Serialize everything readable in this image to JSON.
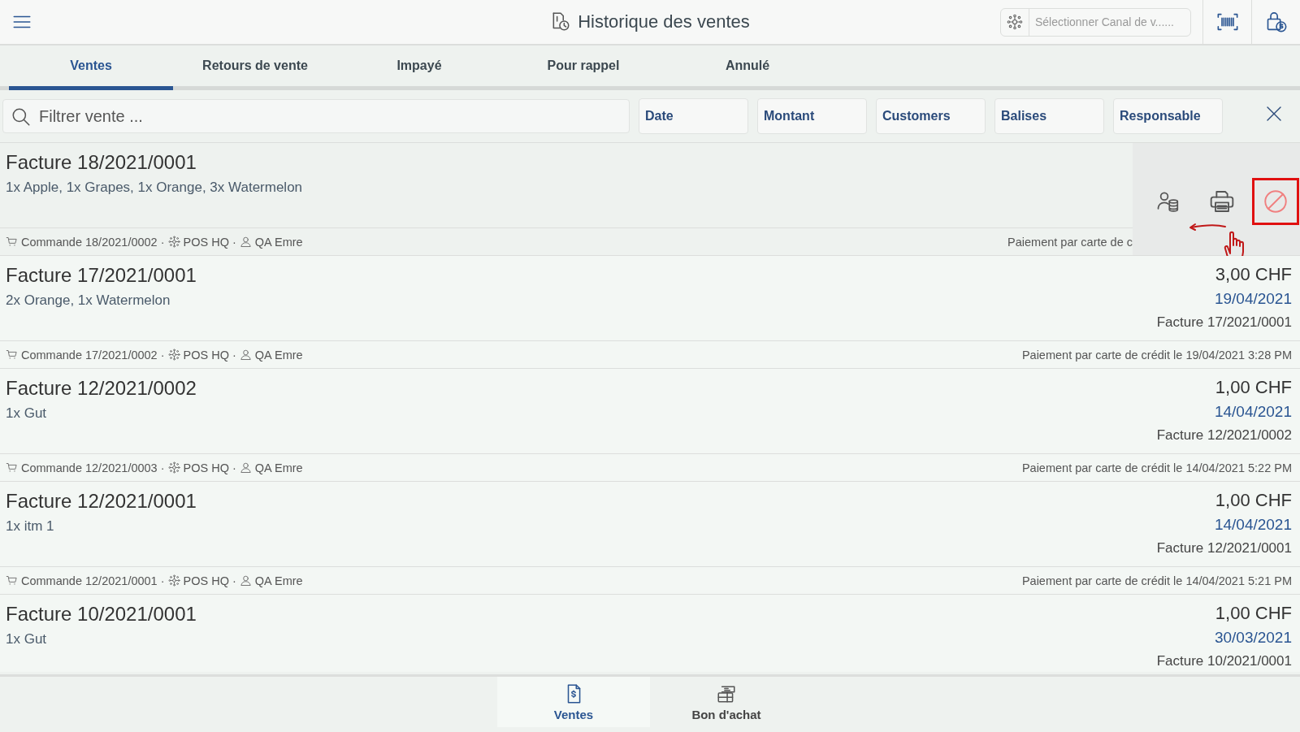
{
  "header": {
    "title": "Historique des ventes",
    "channel_placeholder": "Sélectionner Canal de v......"
  },
  "tabs": [
    {
      "label": "Ventes",
      "selected": true
    },
    {
      "label": "Retours de vente",
      "selected": false
    },
    {
      "label": "Impayé",
      "selected": false
    },
    {
      "label": "Pour rappel",
      "selected": false
    },
    {
      "label": "Annulé",
      "selected": false
    }
  ],
  "filter": {
    "placeholder": "Filtrer vente ...",
    "chips": [
      "Date",
      "Montant",
      "Customers",
      "Balises",
      "Responsable"
    ]
  },
  "rows": [
    {
      "title": "Facture 18/2021/0001",
      "items": "1x Apple, 1x Grapes, 1x Orange, 3x Watermelon",
      "order": "Commande 18/2021/0002 ·",
      "channel": "POS HQ ·",
      "user": "QA Emre",
      "payment": "Paiement par carte de c",
      "actions_open": true
    },
    {
      "title": "Facture 17/2021/0001",
      "items": "2x Orange, 1x Watermelon",
      "amount": "3,00 CHF",
      "date": "19/04/2021",
      "invoice": "Facture 17/2021/0001",
      "order": "Commande 17/2021/0002 ·",
      "channel": "POS HQ ·",
      "user": "QA Emre",
      "payment": "Paiement par carte de crédit le 19/04/2021 3:28 PM",
      "actions_open": false
    },
    {
      "title": "Facture 12/2021/0002",
      "items": "1x Gut",
      "amount": "1,00 CHF",
      "date": "14/04/2021",
      "invoice": "Facture 12/2021/0002",
      "order": "Commande 12/2021/0003 ·",
      "channel": "POS HQ ·",
      "user": "QA Emre",
      "payment": "Paiement par carte de crédit le 14/04/2021 5:22 PM",
      "actions_open": false
    },
    {
      "title": "Facture 12/2021/0001",
      "items": "1x itm 1",
      "amount": "1,00 CHF",
      "date": "14/04/2021",
      "invoice": "Facture 12/2021/0001",
      "order": "Commande 12/2021/0001 ·",
      "channel": "POS HQ ·",
      "user": "QA Emre",
      "payment": "Paiement par carte de crédit le 14/04/2021 5:21 PM",
      "actions_open": false
    },
    {
      "title": "Facture 10/2021/0001",
      "items": "1x Gut",
      "amount": "1,00 CHF",
      "date": "30/03/2021",
      "invoice": "Facture 10/2021/0001",
      "actions_open": false
    }
  ],
  "bottom_nav": [
    {
      "label": "Ventes",
      "selected": true,
      "kind": "sales"
    },
    {
      "label": "Bon d'achat",
      "selected": false,
      "kind": "voucher"
    }
  ]
}
